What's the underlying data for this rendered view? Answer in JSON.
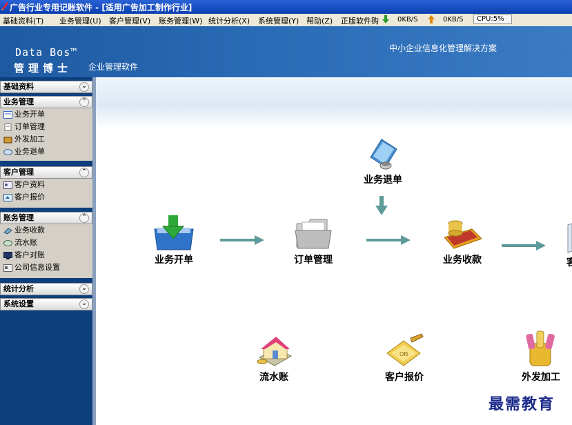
{
  "window": {
    "title": "广告行业专用记账软件 - [适用广告加工制作行业]"
  },
  "menu": {
    "items": [
      "基础资料(T)",
      "业务管理(U)",
      "客户管理(V)",
      "账务管理(W)",
      "统计分析(X)",
      "系统管理(Y)",
      "帮助(Z)",
      "正版软件购"
    ],
    "download_rate": "0KB/S",
    "upload_rate": "0KB/S",
    "cpu": "CPU:5%"
  },
  "header": {
    "brand": "Data Bos™",
    "brand_cn": "管理博士",
    "subtitle": "企业管理软件",
    "slogan": "中小企业信息化管理解决方案"
  },
  "sidebar": {
    "sections": [
      {
        "title": "基础资料",
        "expanded": false,
        "items": []
      },
      {
        "title": "业务管理",
        "expanded": true,
        "items": [
          "业务开单",
          "订单管理",
          "外发加工",
          "业务退单"
        ]
      },
      {
        "title": "客户管理",
        "expanded": true,
        "items": [
          "客户资料",
          "客户报价"
        ]
      },
      {
        "title": "账务管理",
        "expanded": true,
        "items": [
          "业务收款",
          "流水账",
          "客户对账",
          "公司信息设置"
        ]
      },
      {
        "title": "统计分析",
        "expanded": false,
        "items": []
      },
      {
        "title": "系统设置",
        "expanded": false,
        "items": []
      }
    ]
  },
  "flow": {
    "return_order": "业务退单",
    "new_order": "业务开单",
    "order_mgmt": "订单管理",
    "receipt": "业务收款",
    "partial_next": "客",
    "journal": "流水账",
    "quote": "客户报价",
    "outsource": "外发加工"
  },
  "watermark": "最需教育",
  "colors": {
    "titlebar": "#0b3fb0",
    "header": "#2a6bb5",
    "sidebar": "#0e3f7d",
    "arrow": "#5f9a9a"
  }
}
